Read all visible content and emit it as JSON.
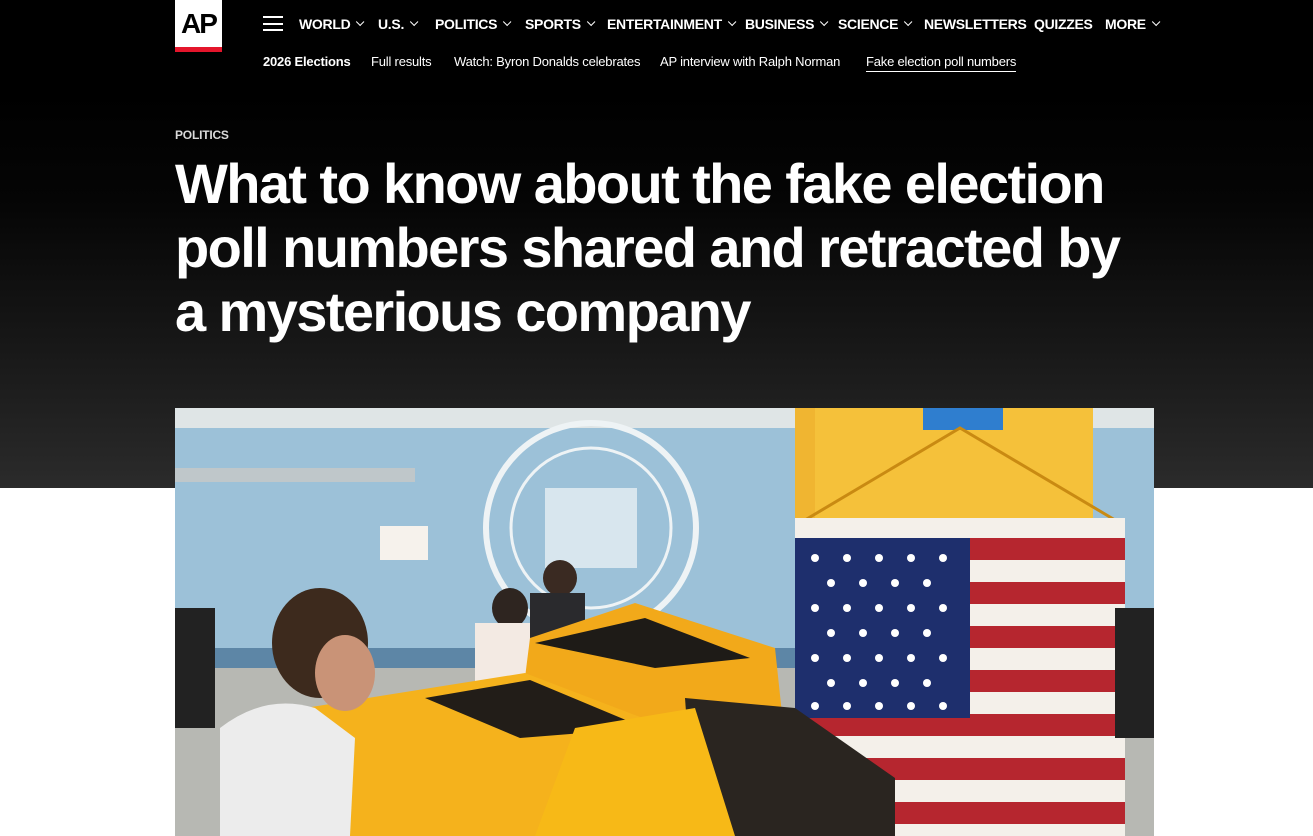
{
  "header": {
    "logo_text": "AP",
    "menu_icon": "hamburger-menu-icon",
    "nav": [
      {
        "label": "WORLD",
        "dropdown": true
      },
      {
        "label": "U.S.",
        "dropdown": true
      },
      {
        "label": "POLITICS",
        "dropdown": true
      },
      {
        "label": "SPORTS",
        "dropdown": true
      },
      {
        "label": "ENTERTAINMENT",
        "dropdown": true
      },
      {
        "label": "BUSINESS",
        "dropdown": true
      },
      {
        "label": "SCIENCE",
        "dropdown": true
      },
      {
        "label": "NEWSLETTERS",
        "dropdown": false
      },
      {
        "label": "QUIZZES",
        "dropdown": false
      },
      {
        "label": "MORE",
        "dropdown": true
      }
    ],
    "subnav": [
      "2026 Elections",
      "Full results",
      "Watch: Byron Donalds celebrates",
      "AP interview with Ralph Norman",
      "Fake election poll numbers"
    ]
  },
  "article": {
    "section": "POLITICS",
    "headline": "What to know about the fake election poll numbers shared and retracted by a mysterious company"
  },
  "colors": {
    "background_dark": "#000000",
    "logo_underline": "#e4152b",
    "booth_yellow": "#f5b21c"
  }
}
